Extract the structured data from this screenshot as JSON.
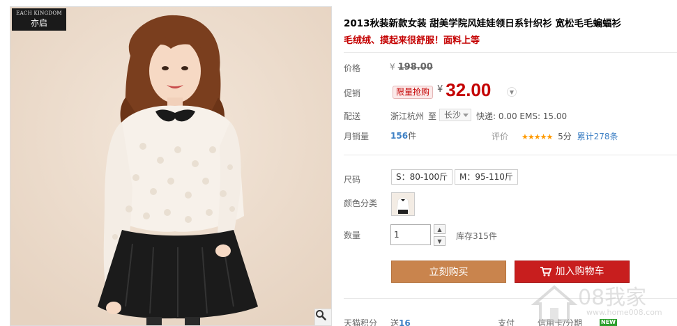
{
  "product": {
    "title": "2013秋装新款女装 甜美学院风娃娃领日系针织衫 宽松毛毛蝙蝠衫",
    "subtitle": "毛绒绒、摸起来很舒服！面料上等"
  },
  "brand": {
    "en": "EACH KINGDOM",
    "cn": "亦启"
  },
  "price": {
    "label": "价格",
    "currency": "¥",
    "original": "198.00",
    "promo_label": "促销",
    "promo_badge": "限量抢购",
    "current": "32.00"
  },
  "shipping": {
    "label": "配送",
    "from": "浙江杭州",
    "to_label": "至",
    "to_city": "长沙",
    "fee": "快递: 0.00 EMS: 15.00"
  },
  "sales": {
    "label": "月销量",
    "count": "156",
    "unit": "件",
    "rating_label": "评价",
    "stars": "★★★★★",
    "score": "5分",
    "reviews": "累计278条"
  },
  "sku": {
    "size_label": "尺码",
    "sizes": [
      "S：80-100斤",
      "M：95-110斤"
    ],
    "color_label": "颜色分类"
  },
  "quantity": {
    "label": "数量",
    "value": "1",
    "stock": "库存315件"
  },
  "actions": {
    "buy": "立刻购买",
    "cart": "加入购物车"
  },
  "footer": {
    "points_label": "天猫积分",
    "points_value_prefix": "送",
    "points_value": "16",
    "pay_label": "支付",
    "pay_value": "信用卡/分期",
    "new_tag": "NEW"
  },
  "watermark": {
    "text": "08我家",
    "url": "www.home008.com"
  },
  "colors": {
    "price_red": "#c40000",
    "buy_button": "#c9844d",
    "cart_button": "#c81e1e",
    "link_blue": "#3c7fc4"
  }
}
